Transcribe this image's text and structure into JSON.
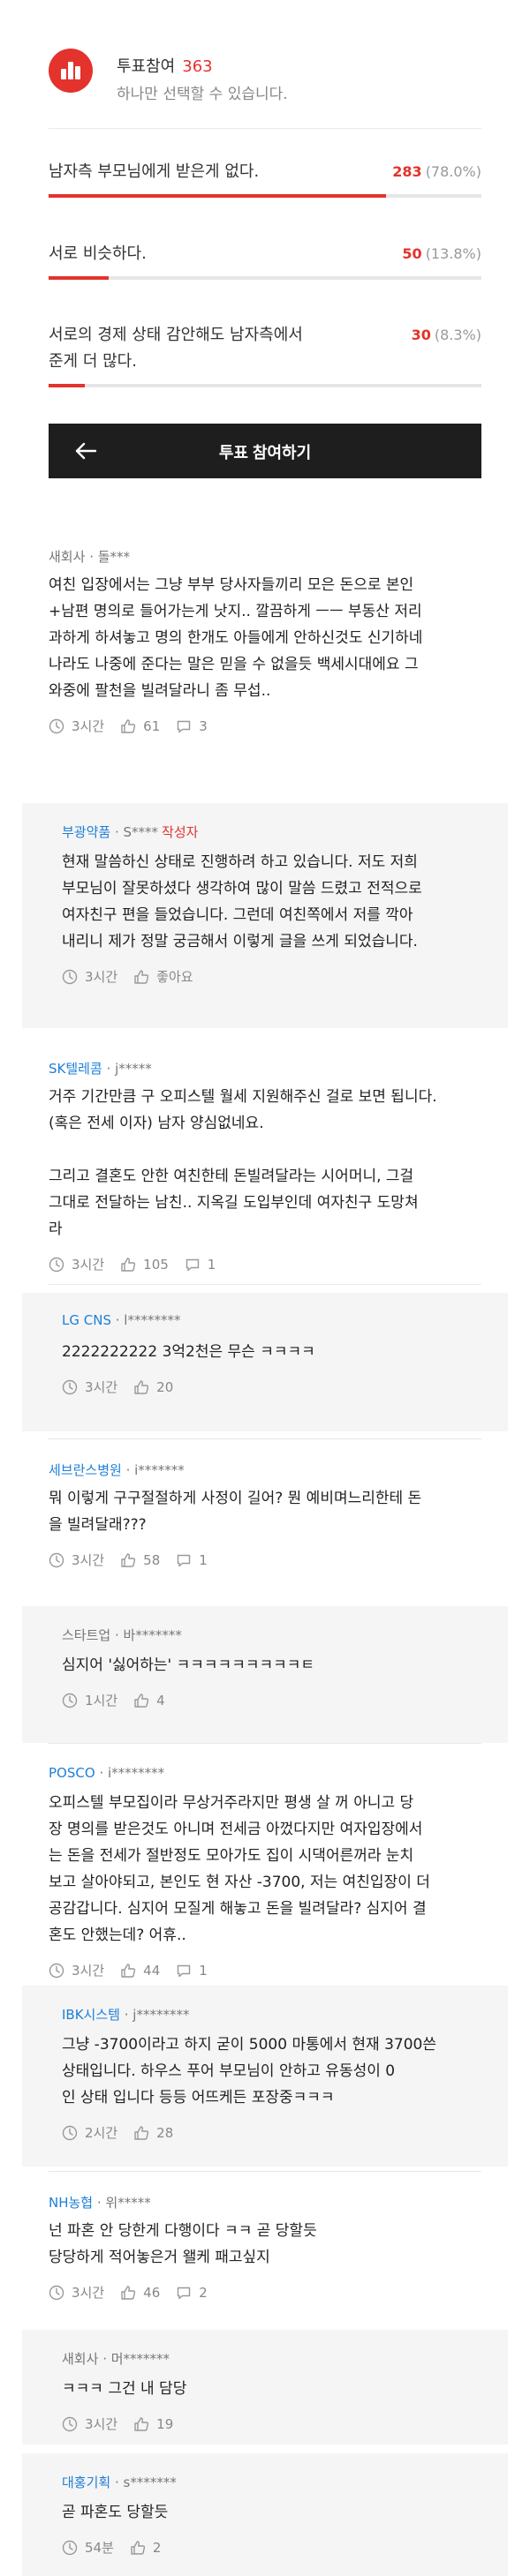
{
  "poll": {
    "title": "투표참여",
    "count": "363",
    "subtitle": "하나만 선택할 수 있습니다.",
    "options": [
      {
        "lines": [
          "남자측 부모님에게 받은게 없다."
        ],
        "count": "283",
        "pct": "(78.0%)",
        "fraction": 0.78
      },
      {
        "lines": [
          "서로 비슷하다."
        ],
        "count": "50",
        "pct": "(13.8%)",
        "fraction": 0.138
      },
      {
        "lines": [
          "서로의 경제 상태 감안해도 남자측에서",
          "준게 더 많다."
        ],
        "count": "30",
        "pct": "(8.3%)",
        "fraction": 0.083
      }
    ],
    "submit_label": "투표 참여하기"
  },
  "comments": [
    {
      "company": "새회사",
      "user": "· 돌***",
      "writer": "",
      "company_plain": true,
      "lines": [
        "여친 입장에서는 그냥 부부 당사자들끼리 모은 돈으로 본인",
        "+남편 명의로 들어가는게 낫지.. 깔끔하게 ㅡㅡ 부동산 저리",
        "과하게 하셔놓고 명의 한개도 아들에게 안하신것도 신기하네",
        "나라도 나중에 준다는 말은 믿을 수 없을듯 백세시대에요 그",
        "와중에 팔천을 빌려달라니 좀 무섭.."
      ],
      "time": "3시간",
      "likes": "61",
      "replies": "3"
    },
    {
      "company": "부광약품",
      "user": "· S****",
      "writer": "작성자",
      "reply": true,
      "lines": [
        "현재 말씀하신 상태로 진행하려 하고 있습니다. 저도 저희",
        "부모님이 잘못하셨다 생각하여 많이 말씀 드렸고 전적으로",
        "여자친구 편을 들었습니다. 그런데 여친쪽에서 저를 깍아",
        "내리니 제가 정말 궁금해서 이렇게 글을 쓰게 되었습니다."
      ],
      "time": "3시간",
      "likes": "좋아요"
    },
    {
      "company": "SK텔레콤",
      "user": "· j*****",
      "writer": "",
      "lines": [
        "거주 기간만큼 구 오피스텔 월세 지원해주신 걸로 보면 됩니다.",
        "(혹은 전세 이자) 남자 양심없네요.",
        "",
        "그리고 결혼도 안한 여친한테 돈빌려달라는 시어머니, 그걸",
        "그대로 전달하는 남친.. 지옥길 도입부인데 여자친구 도망쳐",
        "라"
      ],
      "time": "3시간",
      "likes": "105",
      "replies": "1"
    },
    {
      "company": "LG CNS",
      "user": "· l********",
      "writer": "",
      "reply": true,
      "lines": [
        "2222222222 3억2천은 무슨 ㅋㅋㅋㅋ"
      ],
      "time": "3시간",
      "likes": "20"
    },
    {
      "company": "세브란스병원",
      "user": "· i*******",
      "writer": "",
      "lines": [
        "뭐 이렇게 구구절절하게 사정이 길어? 뭔 예비며느리한테 돈",
        "을 빌려달래???"
      ],
      "time": "3시간",
      "likes": "58",
      "replies": "1"
    },
    {
      "company": "스타트업",
      "user": "· 바*******",
      "writer": "",
      "reply": true,
      "company_plain": true,
      "lines": [
        "심지어 '싫어하는' ㅋㅋㅋㅋㅋㅋㅋㅋㅋㅌ"
      ],
      "time": "1시간",
      "likes": "4"
    },
    {
      "company": "POSCO",
      "user": "· i********",
      "writer": "",
      "lines": [
        "오피스텔 부모집이라 무상거주라지만 평생 살 꺼 아니고 당",
        "장 명의를 받은것도 아니며 전세금 아껐다지만 여자입장에서",
        "는 돈을 전세가 절반정도 모아가도 집이 시댁어른꺼라 눈치",
        "보고 살아야되고, 본인도 현 자산 -3700, 저는 여친입장이 더",
        "공감갑니다. 심지어 모질게 해놓고 돈을 빌려달라? 심지어 결",
        "혼도 안했는데? 어휴.."
      ],
      "time": "3시간",
      "likes": "44",
      "replies": "1"
    },
    {
      "company": "IBK시스템",
      "user": "· j********",
      "writer": "",
      "reply": true,
      "lines": [
        "그냥 -3700이라고 하지 굳이 5000 마통에서 현재 3700쓴",
        "상태입니다. 하우스 푸어 부모님이 안하고 유동성이 0",
        "인 상태 입니다 등등 어뜨케든 포장중ㅋㅋㅋ"
      ],
      "time": "2시간",
      "likes": "28"
    },
    {
      "company": "NH농협",
      "user": "· 위*****",
      "writer": "",
      "lines": [
        "넌 파혼 안 당한게 다행이다 ㅋㅋ 곧 당할듯",
        "당당하게 적어놓은거 왤케 패고싶지"
      ],
      "time": "3시간",
      "likes": "46",
      "replies": "2"
    },
    {
      "company": "새회사",
      "user": "· 머*******",
      "writer": "",
      "reply": true,
      "company_plain": true,
      "lines": [
        "ㅋㅋㅋ 그건 내 담당"
      ],
      "time": "3시간",
      "likes": "19"
    },
    {
      "company": "대홍기획",
      "user": "· s*******",
      "writer": "",
      "reply": true,
      "lines": [
        "곧 파혼도 당할듯"
      ],
      "time": "54분",
      "likes": "2"
    }
  ]
}
